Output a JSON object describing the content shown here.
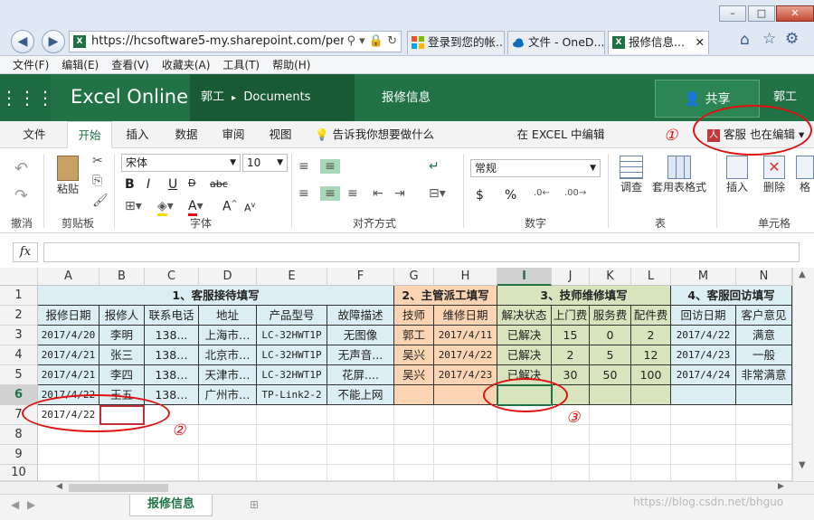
{
  "browser": {
    "window_controls": {
      "minimize": "–",
      "maximize": "□",
      "close": "✕"
    },
    "url": "https://hcsoftware5-my.sharepoint.com/persor",
    "url_icons": [
      "search-icon",
      "dropdown-icon",
      "lock-icon",
      "refresh-icon"
    ],
    "tabs": [
      {
        "label": "登录到您的帐...",
        "icon": "microsoft-logo-icon"
      },
      {
        "label": "文件 - OneD...",
        "icon": "onedrive-icon"
      },
      {
        "label": "报修信息...",
        "icon": "excel-icon",
        "close": "✕"
      }
    ],
    "toolbar_icons": [
      "home-icon",
      "star-icon",
      "gear-icon"
    ],
    "menu": [
      "文件(F)",
      "编辑(E)",
      "查看(V)",
      "收藏夹(A)",
      "工具(T)",
      "帮助(H)"
    ]
  },
  "excel": {
    "app_name": "Excel Online",
    "breadcrumb_owner": "郭工",
    "breadcrumb_sep": "▸",
    "breadcrumb_folder": "Documents",
    "doc_title": "报修信息",
    "share_label": "共享",
    "user_name": "郭工",
    "ribbon_tabs": [
      "文件",
      "开始",
      "插入",
      "数据",
      "审阅",
      "视图"
    ],
    "tell_me": "告诉我你想要做什么",
    "edit_in_excel": "在 EXCEL 中编辑",
    "coauthor": "客服 也在编辑",
    "coauthor_caret": "▾",
    "ribbon": {
      "undo_group": "撤消",
      "clipboard_group": "剪贴板",
      "paste_label": "粘贴",
      "font_group": "字体",
      "font_name": "宋体",
      "font_size": "10",
      "bold": "B",
      "italic": "I",
      "underline": "U",
      "strike": "abc",
      "align_group": "对齐方式",
      "number_group": "数字",
      "number_format": "常规",
      "currency": "$",
      "percent": "%",
      "table_group": "表",
      "survey_label": "调查",
      "table_style_label": "套用表格式",
      "cells_group": "单元格",
      "insert_label": "插入",
      "delete_label": "删除",
      "format_label": "格"
    },
    "fx_label": "fx",
    "columns": [
      "A",
      "B",
      "C",
      "D",
      "E",
      "F",
      "G",
      "H",
      "I",
      "J",
      "K",
      "L",
      "M",
      "N"
    ],
    "rows": [
      "1",
      "2",
      "3",
      "4",
      "5",
      "6",
      "7",
      "8",
      "9",
      "10"
    ],
    "section_headers": [
      "1、客服接待填写",
      "2、主管派工填写",
      "3、技师维修填写",
      "4、客服回访填写"
    ],
    "field_headers": [
      "报修日期",
      "报修人",
      "联系电话",
      "地址",
      "产品型号",
      "故障描述",
      "技师",
      "维修日期",
      "解决状态",
      "上门费",
      "服务费",
      "配件费",
      "回访日期",
      "客户意见"
    ],
    "data_rows": [
      [
        "2017/4/20",
        "李明",
        "138...",
        "上海市…",
        "LC-32HWT1P",
        "无图像",
        "郭工",
        "2017/4/11",
        "已解决",
        "15",
        "0",
        "2",
        "2017/4/22",
        "满意"
      ],
      [
        "2017/4/21",
        "张三",
        "138…",
        "北京市…",
        "LC-32HWT1P",
        "无声音...",
        "吴兴",
        "2017/4/22",
        "已解决",
        "2",
        "5",
        "12",
        "2017/4/23",
        "一般"
      ],
      [
        "2017/4/21",
        "李四",
        "138…",
        "天津市…",
        "LC-32HWT1P",
        "花屏....",
        "吴兴",
        "2017/4/23",
        "已解决",
        "30",
        "50",
        "100",
        "2017/4/24",
        "非常满意"
      ],
      [
        "2017/4/22",
        "王五",
        "138…",
        "广州市…",
        "TP-Link2-2",
        "不能上网",
        "",
        "",
        "",
        "",
        "",
        "",
        "",
        ""
      ]
    ],
    "row7_date": "2017/4/22",
    "sheet_tab": "报修信息",
    "markers": [
      "①",
      "②",
      "③"
    ],
    "watermark": "https://blog.csdn.net/bhguo"
  }
}
